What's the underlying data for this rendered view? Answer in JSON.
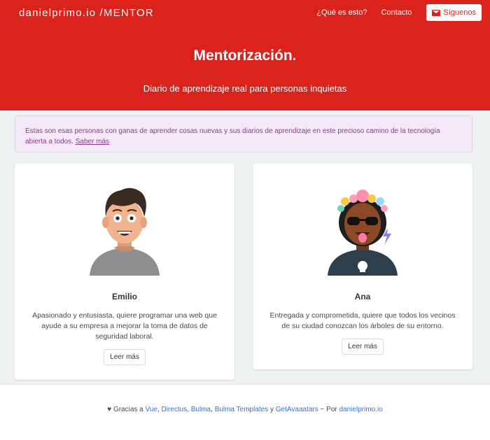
{
  "header": {
    "brand": "danielprimo.io /MENTOR",
    "nav": [
      "¿Qué es esto?",
      "Contacto"
    ],
    "follow_label": "Síguenos"
  },
  "hero": {
    "title": "Mentorización.",
    "subtitle": "Diario de aprendizaje real para personas inquietas"
  },
  "notice": {
    "text": "Estas son esas personas con ganas de aprender cosas nuevas y sus diarios de aprendizaje en este precioso camino de la tecnología abierta a todos. ",
    "link": "Saber más"
  },
  "cards": [
    {
      "name": "Emilio",
      "description": "Apasionado y entusiasta, quiere programar una web que ayude a su empresa a mejorar la toma de datos de seguridad laboral.",
      "button": "Leer más"
    },
    {
      "name": "Ana",
      "description": "Entregada y comprometida, quiere que todos los vecinos de su ciudad conozcan los árboles de su entorno.",
      "button": "Leer más"
    }
  ],
  "footer": {
    "prefix": "Gracias a",
    "links": [
      "Vue",
      "Directus",
      "Bulma",
      "Bulma Templates",
      "GetAvaaatars",
      "danielprimo.io"
    ],
    "sep_and": "y",
    "sep_by": "~ Por"
  },
  "colors": {
    "brand_red": "#d9231c",
    "notice_bg": "#f5e9f7",
    "link_blue": "#3273dc"
  }
}
